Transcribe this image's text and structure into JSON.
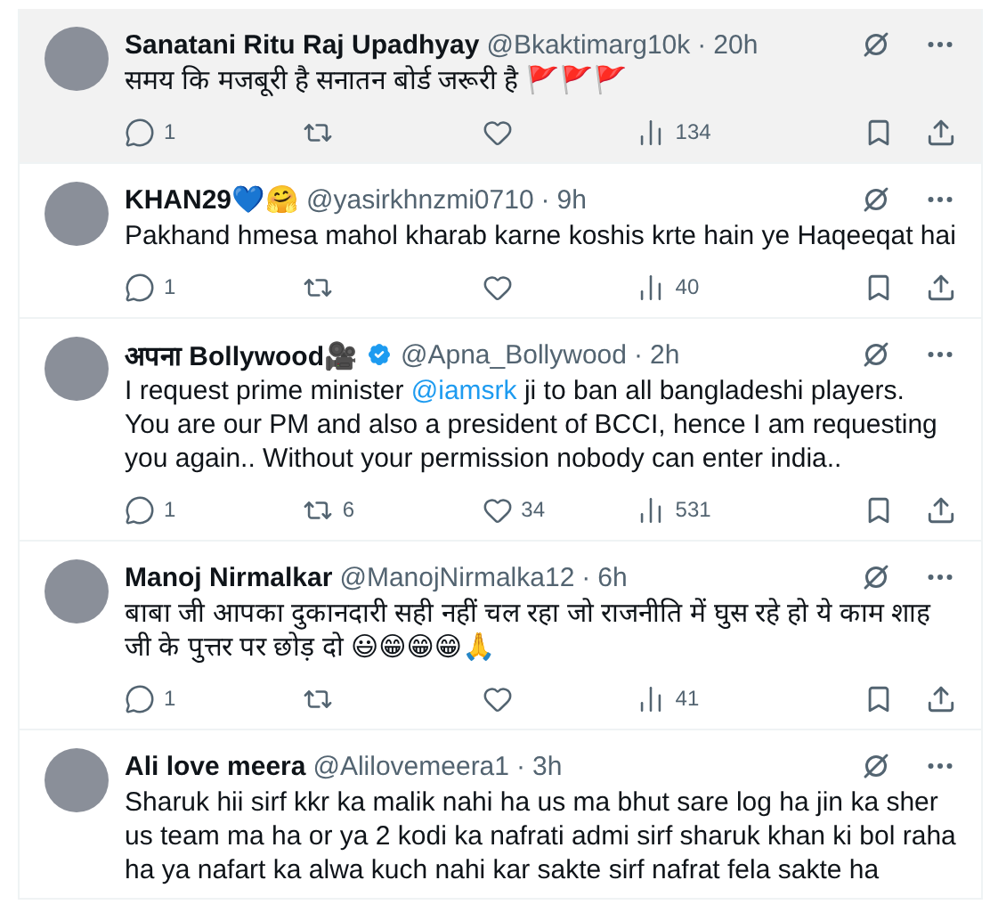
{
  "replies": [
    {
      "name": "Sanatani Ritu Raj Upadhyay",
      "handle": "@Bkaktimarg10k",
      "separator": "·",
      "time": "20h",
      "highlighted": true,
      "text": [
        {
          "kind": "plain",
          "text": "समय कि मजबूरी है सनातन बोर्ड जरूरी है 🚩🚩🚩"
        }
      ],
      "actions": {
        "replies": "1",
        "views": "134"
      }
    },
    {
      "name": "KHAN29💙🤗",
      "handle": "@yasirkhnzmi0710",
      "separator": "·",
      "time": "9h",
      "highlighted": false,
      "text": [
        {
          "kind": "plain",
          "text": "Pakhand hmesa mahol kharab karne koshis krte hain ye Haqeeqat hai"
        }
      ],
      "actions": {
        "replies": "1",
        "views": "40"
      }
    },
    {
      "name": "अपना Bollywood🎥",
      "verified": true,
      "handle": "@Apna_Bollywood",
      "separator": "·",
      "time": "2h",
      "highlighted": false,
      "text": [
        {
          "kind": "plain",
          "text": "I request prime minister "
        },
        {
          "kind": "mention",
          "text": "@iamsrk"
        },
        {
          "kind": "plain",
          "text": " ji to ban all bangladeshi players. You are our PM and also a president of BCCI, hence I am requesting you again.. Without your permission nobody can enter india.."
        }
      ],
      "actions": {
        "replies": "1",
        "reposts": "6",
        "likes": "34",
        "views": "531"
      }
    },
    {
      "name": "Manoj Nirmalkar",
      "handle": "@ManojNirmalka12",
      "separator": "·",
      "time": "6h",
      "highlighted": false,
      "text": [
        {
          "kind": "plain",
          "text": "बाबा जी आपका दुकानदारी सही नहीं चल रहा जो राजनीति में घुस रहे हो ये काम शाह जी के पुत्तर पर छोड़ दो 😃😁😁😁🙏"
        }
      ],
      "actions": {
        "replies": "1",
        "views": "41"
      }
    },
    {
      "name": "Ali love meera",
      "handle": "@Alilovemeera1",
      "separator": "·",
      "time": "3h",
      "highlighted": false,
      "text": [
        {
          "kind": "plain",
          "text": "Sharuk hii sirf kkr ka malik nahi ha us ma bhut sare log ha jin ka sher us team ma ha or ya 2 kodi ka nafrati admi sirf sharuk khan ki bol raha ha ya nafart ka alwa kuch nahi kar sakte sirf nafrat fela sakte ha"
        }
      ]
    }
  ]
}
